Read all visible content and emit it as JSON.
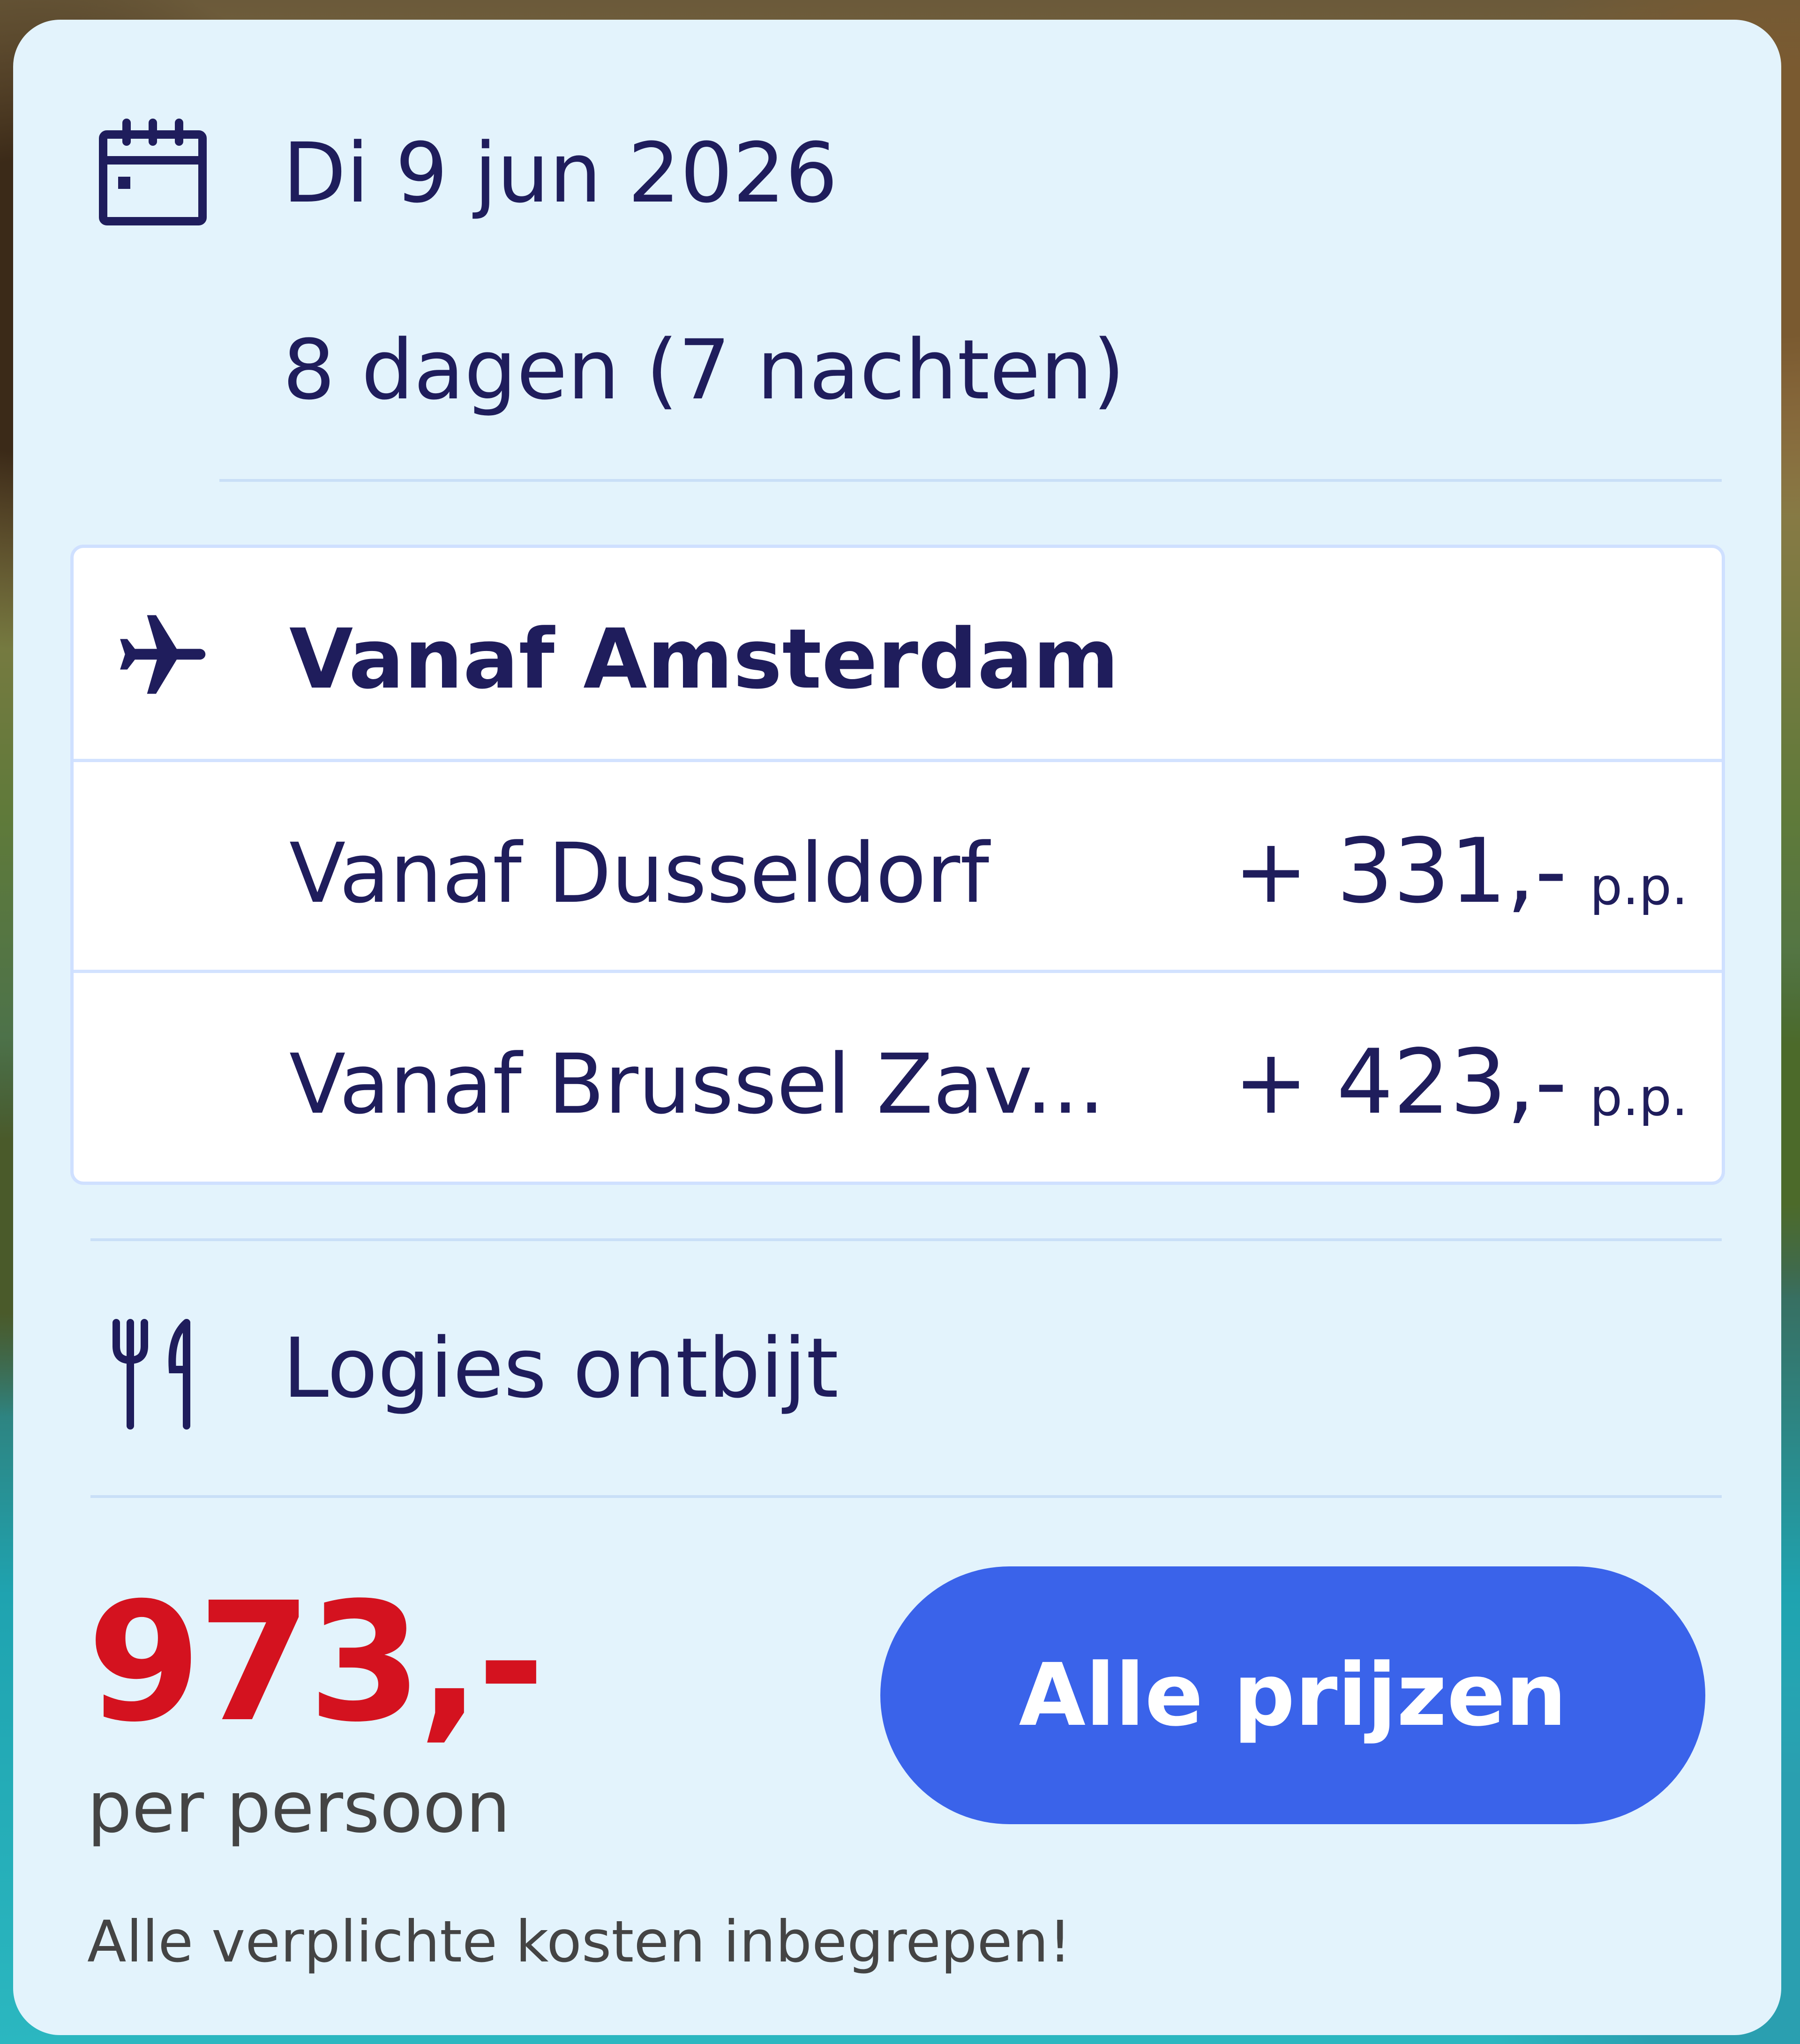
{
  "departure": {
    "date": "Di 9 jun 2026",
    "duration": "8 dagen (7 nachten)"
  },
  "airports": [
    {
      "label": "Vanaf Amsterdam",
      "selected": true,
      "surcharge": "",
      "per_person": ""
    },
    {
      "label": "Vanaf Dusseldorf",
      "selected": false,
      "surcharge": "+ 331,-",
      "per_person": "p.p."
    },
    {
      "label": "Vanaf Brussel Zav...",
      "selected": false,
      "surcharge": "+ 423,-",
      "per_person": "p.p."
    }
  ],
  "board": {
    "label": "Logies ontbijt"
  },
  "pricing": {
    "price": "973,-",
    "per_person_label": "per persoon",
    "note": "Alle verplichte kosten inbegrepen!",
    "cta_label": "Alle prijzen"
  },
  "icons": {
    "date": "calendar-icon",
    "flight": "airplane-icon",
    "board": "cutlery-icon"
  },
  "colors": {
    "card_background": "#e3f3fc",
    "text_primary": "#1f1d5c",
    "price": "#d4121f",
    "cta": "#3a63ea"
  }
}
